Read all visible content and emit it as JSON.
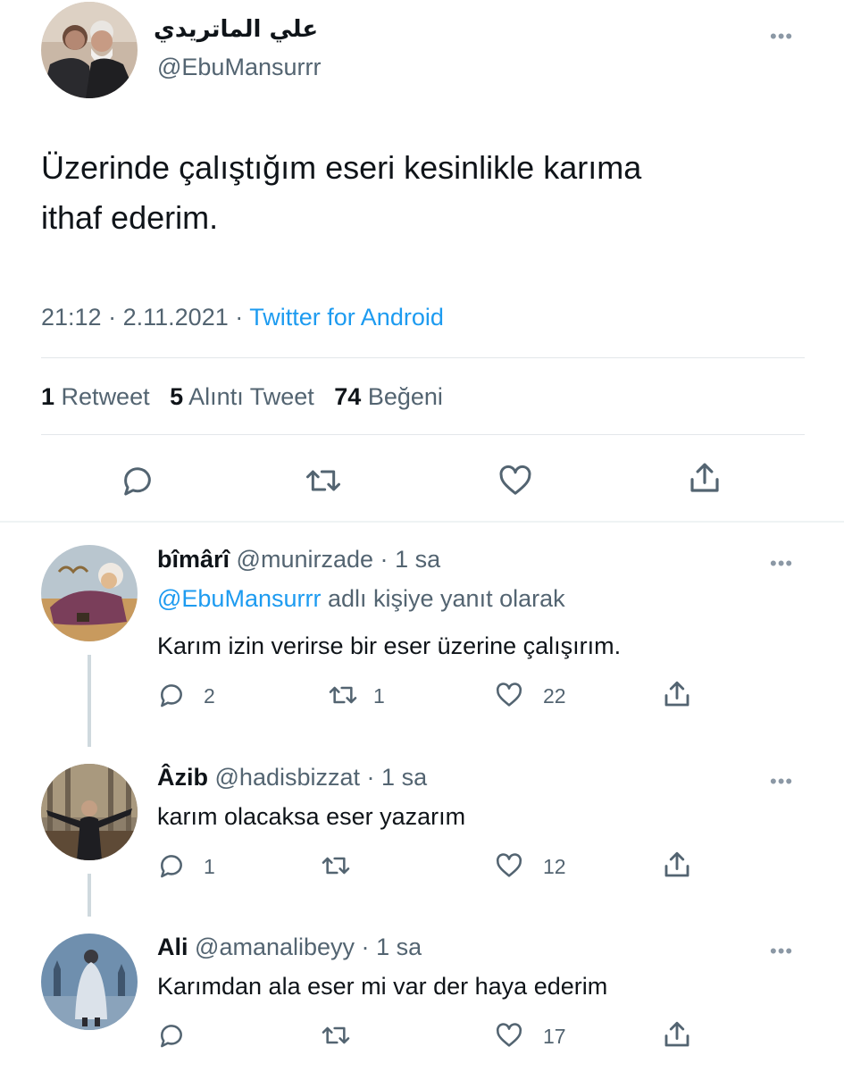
{
  "main_tweet": {
    "author_name": "علي الماتريدي",
    "author_handle": "@EbuMansurrr",
    "text_line1": "Üzerinde çalıştığım eseri kesinlikle karıma",
    "text_line2": "ithaf ederim.",
    "time": "21:12",
    "date": "2.11.2021",
    "source": "Twitter for Android",
    "retweet_count": "1",
    "retweet_label": "Retweet",
    "quote_count": "5",
    "quote_label": "Alıntı Tweet",
    "like_count": "74",
    "like_label": "Beğeni"
  },
  "replies": [
    {
      "name": "bîmârî",
      "handle": "@munirzade",
      "time": "1 sa",
      "reply_to_handle": "@EbuMansurrr",
      "reply_to_suffix": "adlı kişiye yanıt olarak",
      "text": "Karım izin verirse bir eser üzerine çalışırım.",
      "reply_count": "2",
      "retweet_count": "1",
      "like_count": "22"
    },
    {
      "name": "Âzib",
      "handle": "@hadisbizzat",
      "time": "1 sa",
      "text": "karım olacaksa eser yazarım",
      "reply_count": "1",
      "retweet_count": "",
      "like_count": "12"
    },
    {
      "name": "Ali",
      "handle": "@amanalibeyy",
      "time": "1 sa",
      "text": "Karımdan ala eser mi var der haya ederim",
      "reply_count": "",
      "retweet_count": "",
      "like_count": "17"
    }
  ],
  "separators": {
    "dot": "·",
    "more": "•••"
  },
  "colors": {
    "accent": "#1d9bf0",
    "secondary_text": "#536471",
    "divider": "#e3e7ea"
  },
  "icons": [
    "reply-icon",
    "retweet-icon",
    "like-icon",
    "share-icon",
    "more-icon"
  ]
}
